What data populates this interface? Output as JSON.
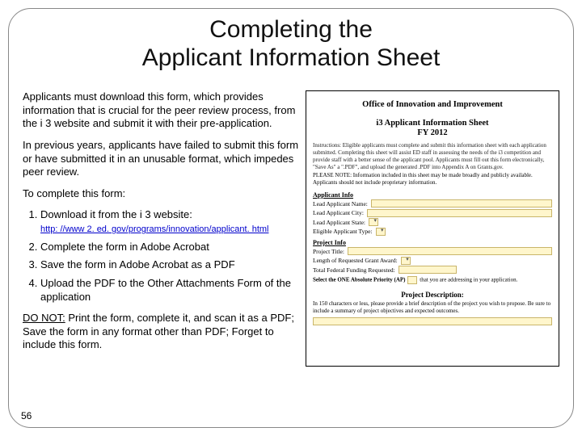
{
  "title_l1": "Completing the",
  "title_l2": "Applicant Information Sheet",
  "para1": "Applicants must download this form, which provides information that is crucial for the peer review process, from the i 3 website and submit it with their pre-application.",
  "para2": "In previous years, applicants have failed to submit this form or have submitted it in an unusable format, which impedes peer review.",
  "para3": "To complete this form:",
  "step1": "Download it from the i 3 website:",
  "link": "http: //www 2. ed. gov/programs/innovation/applicant. html",
  "step2": "Complete the form in Adobe Acrobat",
  "step3": "Save the form in Adobe Acrobat as a PDF",
  "step4": "Upload the PDF to the Other Attachments Form of the application",
  "donot_label": "DO NOT:",
  "donot_text": " Print the form, complete it, and scan it as a PDF; Save the form in any format other than PDF; Forget to include this form.",
  "page": "56",
  "form": {
    "t1": "Office of Innovation and Improvement",
    "t2": "i3 Applicant Information Sheet",
    "t3": "FY 2012",
    "instr": "Instructions: Eligible applicants must complete and submit this information sheet with each application submitted. Completing this sheet will assist ED staff in assessing the needs of the i3 competition and provide staff with a better sense of the applicant pool. Applicants must fill out this form electronically, \"Save As\" a \".PDF\", and upload the generated .PDF into Appendix A on Grants.gov.",
    "note": "PLEASE NOTE: Information included in this sheet may be made broadly and publicly available. Applicants should not include proprietary information.",
    "s1": "Applicant Info",
    "s1r1": "Lead Applicant Name:",
    "s1r2": "Lead Applicant City:",
    "s1r3": "Lead Applicant State:",
    "s1r4": "Eligible Applicant Type:",
    "s2": "Project Info",
    "s2r1": "Project Title:",
    "s2r2": "Length of Requested Grant Award:",
    "s2r3": "Total Federal Funding Requested:",
    "ap": "Select the ONE Absolute Priority (AP) that you are addressing in your application.",
    "pd": "Project Description:",
    "pdtext": "In 150 characters or less, please provide a brief description of the project you wish to propose. Be sure to include a summary of project objectives and expected outcomes."
  }
}
